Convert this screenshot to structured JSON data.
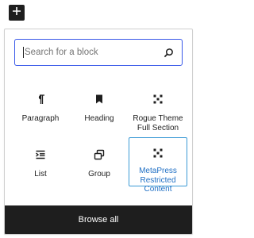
{
  "search": {
    "placeholder": "Search for a block",
    "value": ""
  },
  "blocks": [
    {
      "label": "Paragraph",
      "icon": "pilcrow-icon"
    },
    {
      "label": "Heading",
      "icon": "bookmark-icon"
    },
    {
      "label": "Rogue Theme Full Section",
      "icon": "full-section-icon"
    },
    {
      "label": "List",
      "icon": "list-icon"
    },
    {
      "label": "Group",
      "icon": "group-icon"
    },
    {
      "label": "MetaPress Restricted Content",
      "icon": "restricted-content-icon",
      "highlighted": true
    }
  ],
  "footer": {
    "browse_all_label": "Browse all"
  },
  "colors": {
    "accent": "#3858e9",
    "highlight": "#3b9ad5",
    "dark": "#1e1e1e"
  }
}
